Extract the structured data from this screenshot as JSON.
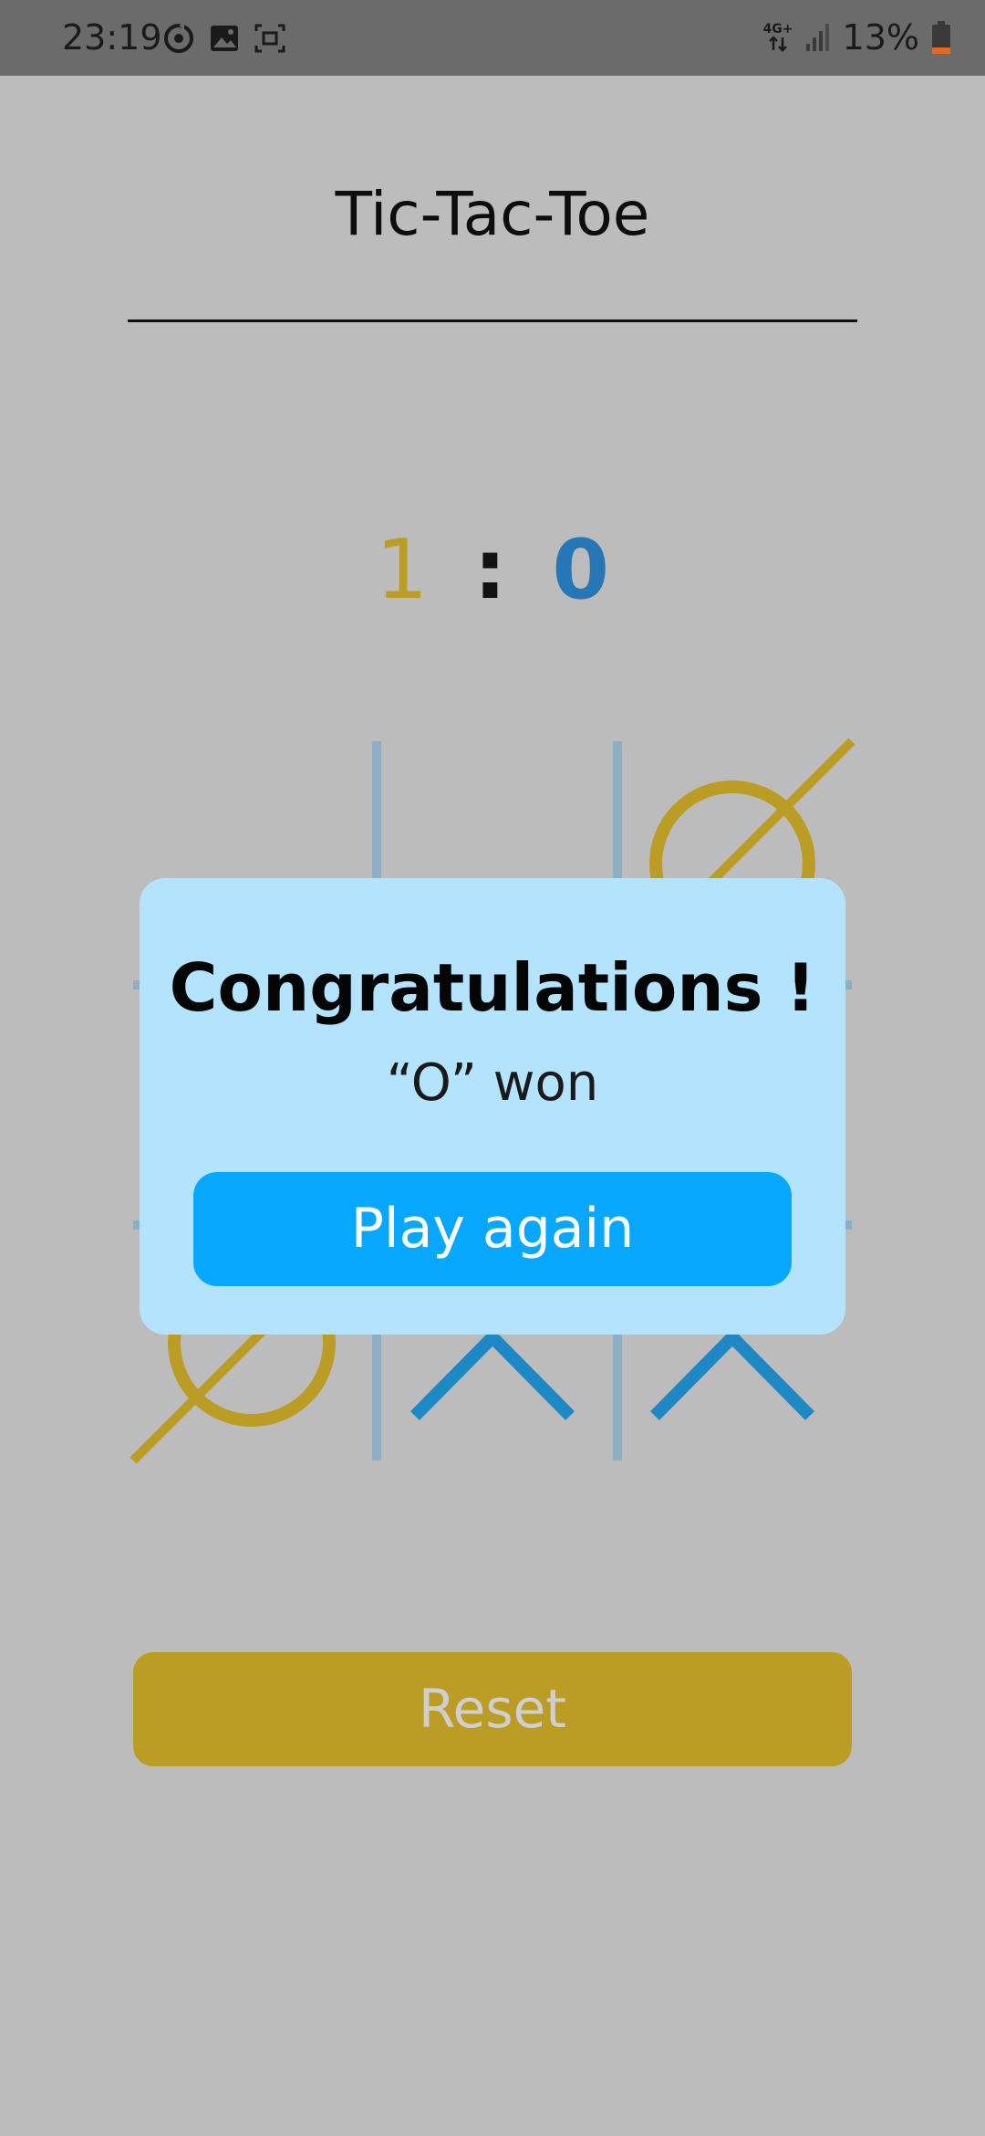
{
  "status_bar": {
    "time": "23:19",
    "network": "4G+",
    "battery": "13%",
    "icons": [
      "sync-icon",
      "gallery-icon",
      "screenshot-icon",
      "data-arrows-icon",
      "signal-icon",
      "battery-icon"
    ]
  },
  "app": {
    "title": "Tic-Tac-Toe"
  },
  "score": {
    "left": "1",
    "separator": ":",
    "right": "0"
  },
  "board": {
    "cells": [
      [
        "",
        "",
        "O"
      ],
      [
        "",
        "",
        ""
      ],
      [
        "O",
        "X",
        "X"
      ]
    ]
  },
  "dialog": {
    "title": "Congratulations !",
    "message": "“O” won",
    "button_label": "Play again"
  },
  "controls": {
    "reset_label": "Reset"
  },
  "colors": {
    "o_color": "#bb9d25",
    "x_color": "#1e88c4",
    "grid_color": "#8eaec3",
    "background": "#bcbcbc",
    "dialog_bg": "#b3e3fd",
    "primary_button": "#06a7fc"
  }
}
